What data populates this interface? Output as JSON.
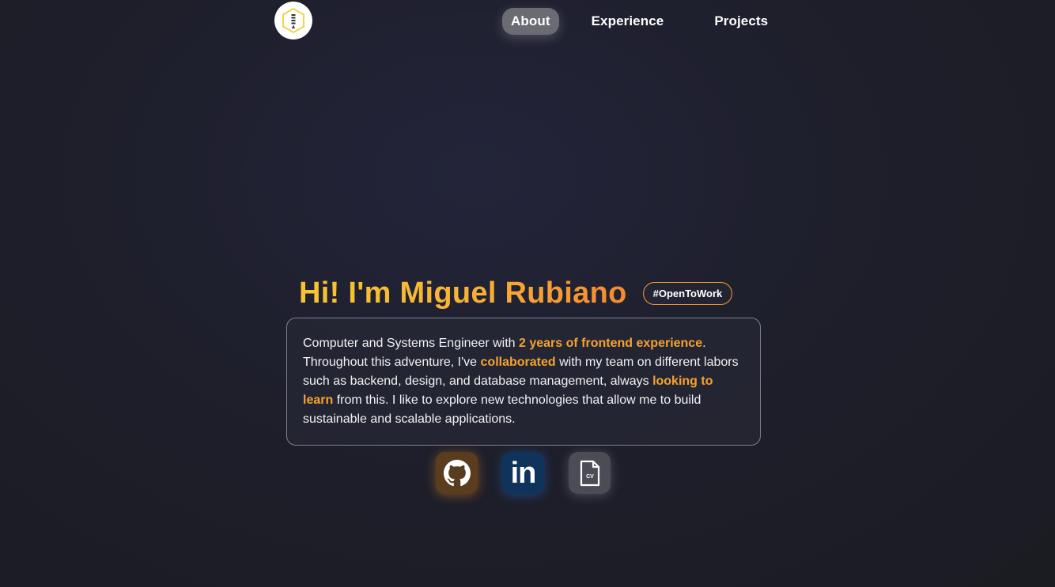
{
  "nav": {
    "items": [
      {
        "label": "About",
        "active": true
      },
      {
        "label": "Experience",
        "active": false
      },
      {
        "label": "Projects",
        "active": false
      }
    ]
  },
  "hero": {
    "title": "Hi! I'm Miguel Rubiano",
    "badge": "#OpenToWork",
    "bio": {
      "p1": "Computer and Systems Engineer with ",
      "h1": "2 years of frontend experience",
      "p2": ". Throughout this adventure, I've ",
      "h2": "collaborated",
      "p3": " with my team on different labors such as backend, design, and database management, always ",
      "h3": "looking to learn",
      "p4": " from this. I like to explore new technologies that allow me to build sustainable and scalable applications."
    }
  },
  "socials": {
    "linkedin_label": "in",
    "cv_label": "CV"
  },
  "colors": {
    "accent": "#f6a22e",
    "background": "#1e1f2a",
    "github_bg": "#5a3d1f",
    "linkedin_bg": "#10335b",
    "cv_bg": "#4b4c55"
  }
}
